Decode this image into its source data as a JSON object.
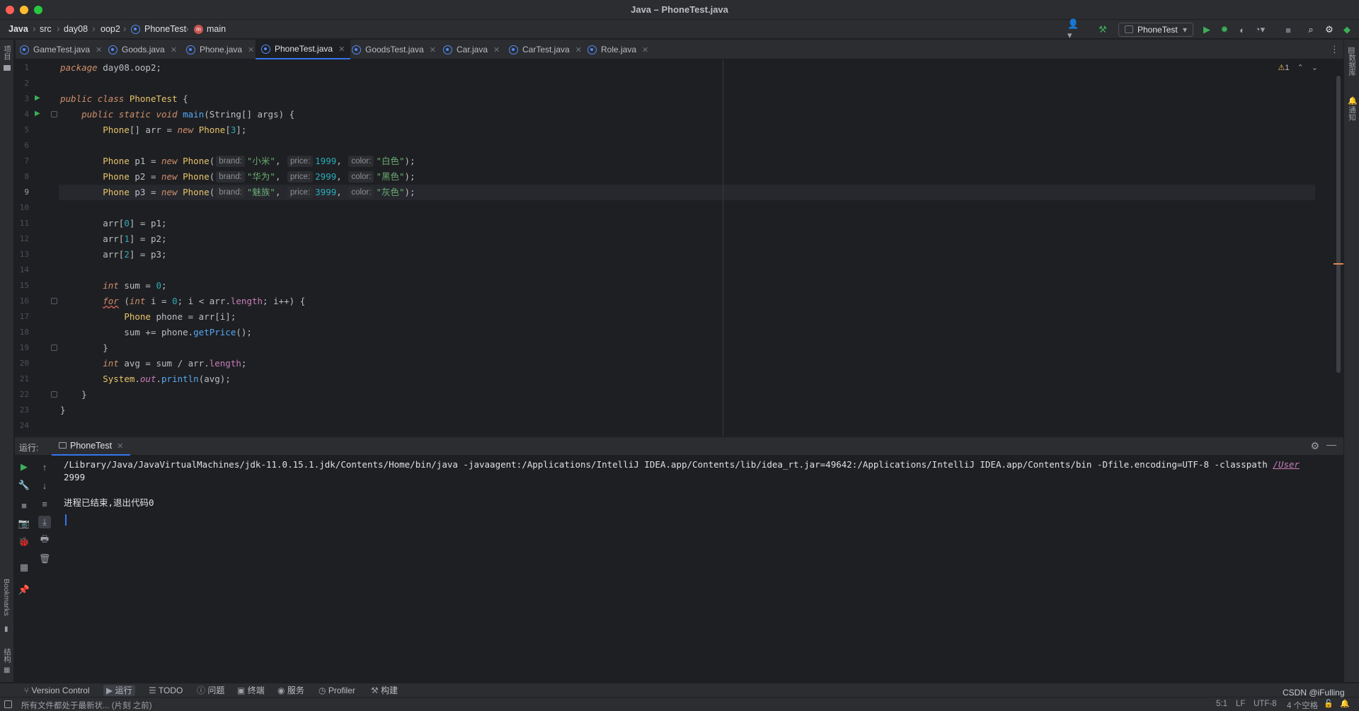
{
  "window": {
    "title": "Java – PhoneTest.java",
    "traffic_colors": [
      "#ff5f57",
      "#febc2e",
      "#28c840"
    ]
  },
  "breadcrumb": {
    "items": [
      "Java",
      "src",
      "day08",
      "oop2",
      "PhoneTest",
      "main"
    ]
  },
  "toolbar": {
    "run_config": "PhoneTest"
  },
  "tabs": [
    {
      "label": "GameTest.java",
      "active": false
    },
    {
      "label": "Goods.java",
      "active": false
    },
    {
      "label": "Phone.java",
      "active": false
    },
    {
      "label": "PhoneTest.java",
      "active": true
    },
    {
      "label": "GoodsTest.java",
      "active": false
    },
    {
      "label": "Car.java",
      "active": false
    },
    {
      "label": "CarTest.java",
      "active": false
    },
    {
      "label": "Role.java",
      "active": false
    }
  ],
  "left_strip": {
    "project": "项目",
    "bookmarks": "Bookmarks",
    "structure": "结构"
  },
  "right_strip": {
    "database": "数据库",
    "notifications": "通知"
  },
  "editor": {
    "warnings_count": "1",
    "line_numbers": [
      "1",
      "2",
      "3",
      "4",
      "5",
      "6",
      "7",
      "8",
      "9",
      "10",
      "11",
      "12",
      "13",
      "14",
      "15",
      "16",
      "17",
      "18",
      "19",
      "20",
      "21",
      "22",
      "23",
      "24"
    ],
    "hints": {
      "brand": "brand:",
      "price": "price:",
      "color": "color:"
    },
    "lines": {
      "l1_pkg": "package",
      "l1_name": " day08.oop2;",
      "l3_public": "public",
      "l3_class": "class",
      "l3_name": "PhoneTest",
      "l3_brace": " {",
      "l4_public": "public",
      "l4_static": "static",
      "l4_void": "void",
      "l4_main": "main",
      "l4_rest": "(String[] args) {",
      "l5_type": "Phone",
      "l5_mid": "[] arr = ",
      "l5_new": "new",
      "l5_cls": "Phone",
      "l5_br1": "[",
      "l5_num": "3",
      "l5_end": "];",
      "p1_decl": " p1 = ",
      "p2_decl": " p2 = ",
      "p3_decl": " p3 = ",
      "p1_brand": "\"小米\"",
      "p2_brand": "\"华为\"",
      "p3_brand": "\"魅族\"",
      "p1_price": "1999",
      "p2_price": "2999",
      "p3_price": "3999",
      "p1_color": "\"白色\"",
      "p2_color": "\"黑色\"",
      "p3_color": "\"灰色\"",
      "arr0": "arr[",
      "arr0_idx": "0",
      "arr0_rest": "] = p1;",
      "arr1_idx": "1",
      "arr1_rest": "] = p2;",
      "arr2_idx": "2",
      "arr2_rest": "] = p3;",
      "int": "int",
      "sum_decl": " sum = ",
      "zero": "0",
      "for": "for",
      "for_open": " (",
      "i_decl": " i = ",
      "for_cond": "; i < arr.",
      "length": "length",
      "for_end": "; i++) {",
      "phone_type": "Phone",
      "phone_decl": " phone = arr[i];",
      "sum_add": "sum += phone.",
      "getPrice": "getPrice",
      "call_end": "();",
      "close_brace": "}",
      "avg_decl": " avg = sum / arr.",
      "semicolon": ";",
      "system": "System",
      "dot": ".",
      "out": "out",
      "println": "println",
      "println_arg": "(avg);"
    }
  },
  "run_panel": {
    "label": "运行:",
    "tab": "PhoneTest",
    "console": {
      "command": "/Library/Java/JavaVirtualMachines/jdk-11.0.15.1.jdk/Contents/Home/bin/java -javaagent:/Applications/IntelliJ IDEA.app/Contents/lib/idea_rt.jar=49642:/Applications/IntelliJ IDEA.app/Contents/bin -Dfile.encoding=UTF-8 -classpath ",
      "command_link": "/User",
      "output": "2999",
      "exit": "进程已结束,退出代码0"
    }
  },
  "bottom_tools": [
    {
      "label": "Version Control",
      "icon": "branch-icon"
    },
    {
      "label": "运行",
      "icon": "play-icon",
      "active": true
    },
    {
      "label": "TODO",
      "icon": "list-icon"
    },
    {
      "label": "问题",
      "icon": "info-icon"
    },
    {
      "label": "终端",
      "icon": "terminal-icon"
    },
    {
      "label": "服务",
      "icon": "services-icon"
    },
    {
      "label": "Profiler",
      "icon": "profiler-icon"
    },
    {
      "label": "构建",
      "icon": "hammer-icon"
    }
  ],
  "status_bar": {
    "message": "所有文件都处于最新状... (片刻 之前)",
    "position": "5:1",
    "line_sep": "LF",
    "encoding": "UTF-8",
    "indent": "4 个空格",
    "watermark": "CSDN @iFulling"
  }
}
